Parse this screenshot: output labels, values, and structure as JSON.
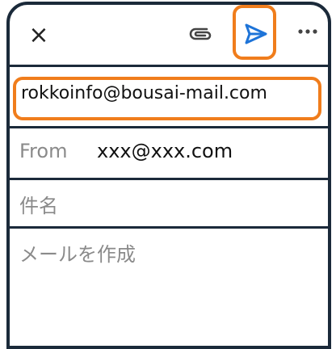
{
  "toolbar": {
    "close_icon": "×",
    "attach_icon": "paperclip-icon",
    "send_icon": "send-icon",
    "more_icon": "more-icon"
  },
  "compose": {
    "to_value": "rokkoinfo@bousai-mail.com",
    "from_label": "From",
    "from_value": "xxx@xxx.com",
    "subject_placeholder": "件名",
    "body_placeholder": "メールを作成"
  },
  "colors": {
    "highlight": "#f07d1c",
    "send_blue": "#1e74d8",
    "frame": "#1b2a3a"
  }
}
